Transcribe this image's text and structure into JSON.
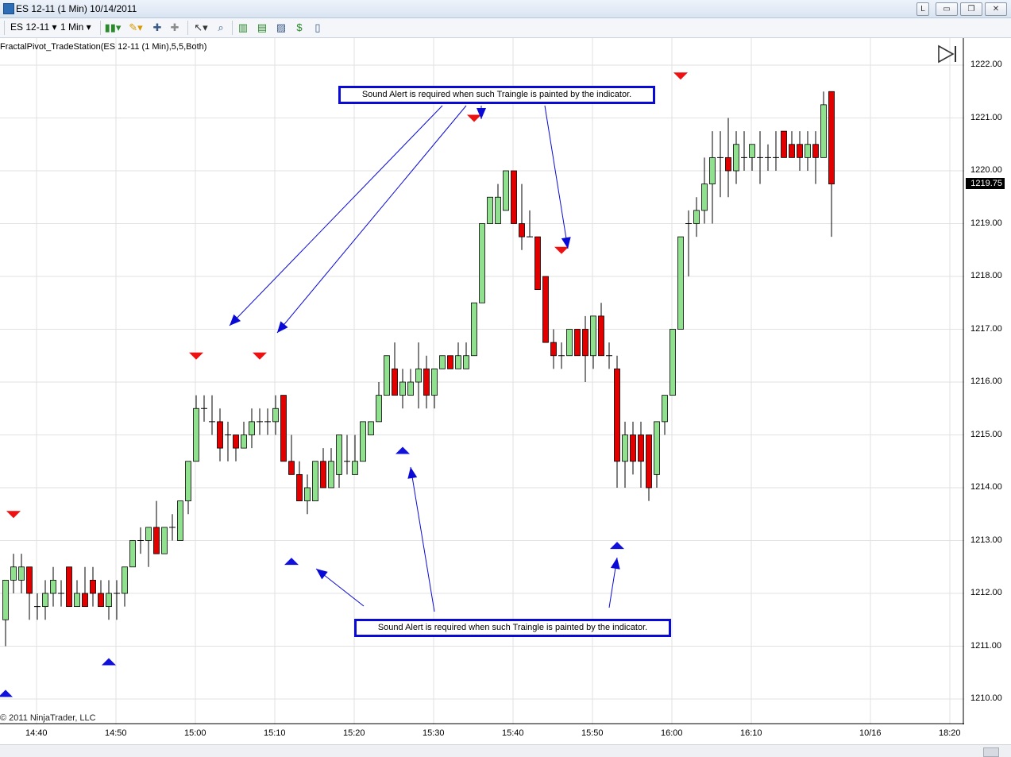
{
  "window": {
    "title": "ES 12-11 (1 Min)  10/14/2011",
    "buttons": [
      "L",
      "▭",
      "❐",
      "✕"
    ]
  },
  "toolbar": {
    "instrument": "ES 12-11",
    "interval": "1 Min",
    "icons": [
      "candlestick-style-icon",
      "pencil-draw-icon",
      "insert-marker-icon",
      "remove-marker-icon",
      "cursor-pointer-icon",
      "zoom-icon",
      "bar-data-icon",
      "properties-icon",
      "chart-trader-icon",
      "dollar-icon",
      "strategy-icon"
    ]
  },
  "indicator_label": "FractalPivot_TradeStation(ES 12-11 (1 Min),5,5,Both)",
  "copyright": "© 2011 NinjaTrader, LLC",
  "current_price": "1219.75",
  "colors": {
    "up": "#90e090",
    "down": "#e00000",
    "up_arrow": "#1111dd",
    "down_arrow": "#ee1111",
    "annotation": "#0a0ad6",
    "grid": "#e2e2e2"
  },
  "annotations": {
    "top_text": "Sound Alert is required when such Traingle is painted by the indicator.",
    "bottom_text": "Sound Alert is required when such Traingle is painted by the indicator."
  },
  "chart_data": {
    "type": "candlestick",
    "x_ticks": [
      "14:40",
      "14:50",
      "15:00",
      "15:10",
      "15:20",
      "15:30",
      "15:40",
      "15:50",
      "16:00",
      "16:10",
      "10/16",
      "18:20"
    ],
    "y_ticks": [
      "1222.00",
      "1221.00",
      "1220.00",
      "1219.00",
      "1218.00",
      "1217.00",
      "1216.00",
      "1215.00",
      "1214.00",
      "1213.00",
      "1212.00",
      "1211.00",
      "1210.00"
    ],
    "ylim": [
      1209.5,
      1222.2
    ],
    "time_start": "14:37",
    "candles": [
      [
        1211.5,
        1212.25,
        1211.0,
        1212.25
      ],
      [
        1212.25,
        1212.75,
        1212.0,
        1212.5
      ],
      [
        1212.25,
        1212.75,
        1212.0,
        1212.5
      ],
      [
        1212.5,
        1212.5,
        1211.5,
        1212.0
      ],
      [
        1211.75,
        1212.0,
        1211.5,
        1211.75
      ],
      [
        1211.75,
        1212.25,
        1211.5,
        1212.0
      ],
      [
        1212.0,
        1212.5,
        1211.75,
        1212.25
      ],
      [
        1212.0,
        1212.25,
        1211.75,
        1212.0
      ],
      [
        1212.5,
        1212.5,
        1211.75,
        1211.75
      ],
      [
        1211.75,
        1212.25,
        1211.75,
        1212.0
      ],
      [
        1212.0,
        1212.5,
        1211.75,
        1211.75
      ],
      [
        1212.25,
        1212.5,
        1211.75,
        1212.0
      ],
      [
        1212.0,
        1212.25,
        1211.75,
        1211.75
      ],
      [
        1211.75,
        1212.25,
        1211.5,
        1212.0
      ],
      [
        1212.0,
        1212.25,
        1211.5,
        1212.0
      ],
      [
        1212.0,
        1212.5,
        1211.75,
        1212.5
      ],
      [
        1212.5,
        1213.0,
        1212.5,
        1213.0
      ],
      [
        1213.0,
        1213.25,
        1212.75,
        1213.0
      ],
      [
        1213.0,
        1213.25,
        1212.5,
        1213.25
      ],
      [
        1213.25,
        1213.75,
        1212.75,
        1212.75
      ],
      [
        1212.75,
        1213.25,
        1212.75,
        1213.25
      ],
      [
        1213.25,
        1213.5,
        1213.0,
        1213.25
      ],
      [
        1213.0,
        1213.75,
        1213.0,
        1213.75
      ],
      [
        1213.75,
        1214.25,
        1213.5,
        1214.5
      ],
      [
        1214.5,
        1215.75,
        1214.5,
        1215.5
      ],
      [
        1215.5,
        1215.75,
        1215.25,
        1215.5
      ],
      [
        1215.25,
        1215.75,
        1215.0,
        1215.25
      ],
      [
        1215.25,
        1215.5,
        1214.5,
        1214.75
      ],
      [
        1215.0,
        1215.25,
        1214.5,
        1215.0
      ],
      [
        1215.0,
        1215.0,
        1214.5,
        1214.75
      ],
      [
        1214.75,
        1215.25,
        1214.75,
        1215.0
      ],
      [
        1215.0,
        1215.5,
        1214.75,
        1215.25
      ],
      [
        1215.25,
        1215.5,
        1215.0,
        1215.25
      ],
      [
        1215.25,
        1215.5,
        1215.0,
        1215.25
      ],
      [
        1215.25,
        1215.75,
        1215.0,
        1215.5
      ],
      [
        1215.75,
        1215.75,
        1214.5,
        1214.5
      ],
      [
        1214.5,
        1215.0,
        1214.25,
        1214.25
      ],
      [
        1214.25,
        1214.5,
        1213.75,
        1213.75
      ],
      [
        1213.75,
        1214.25,
        1213.5,
        1214.0
      ],
      [
        1213.75,
        1214.5,
        1213.75,
        1214.5
      ],
      [
        1214.5,
        1214.75,
        1214.0,
        1214.0
      ],
      [
        1214.0,
        1214.75,
        1214.0,
        1214.5
      ],
      [
        1214.25,
        1215.0,
        1214.0,
        1215.0
      ],
      [
        1214.5,
        1215.0,
        1214.25,
        1214.5
      ],
      [
        1214.25,
        1215.0,
        1214.25,
        1214.5
      ],
      [
        1214.5,
        1215.25,
        1214.5,
        1215.25
      ],
      [
        1215.0,
        1215.25,
        1215.0,
        1215.25
      ],
      [
        1215.25,
        1216.0,
        1215.25,
        1215.75
      ],
      [
        1215.75,
        1216.25,
        1215.75,
        1216.5
      ],
      [
        1216.25,
        1216.75,
        1215.75,
        1215.75
      ],
      [
        1215.75,
        1216.25,
        1215.5,
        1216.0
      ],
      [
        1215.75,
        1216.25,
        1215.75,
        1216.0
      ],
      [
        1216.0,
        1216.75,
        1215.5,
        1216.25
      ],
      [
        1216.25,
        1216.5,
        1215.5,
        1215.75
      ],
      [
        1215.75,
        1216.25,
        1215.5,
        1216.25
      ],
      [
        1216.25,
        1216.5,
        1216.25,
        1216.5
      ],
      [
        1216.5,
        1216.5,
        1216.25,
        1216.25
      ],
      [
        1216.25,
        1216.75,
        1216.25,
        1216.5
      ],
      [
        1216.25,
        1216.75,
        1216.25,
        1216.5
      ],
      [
        1216.5,
        1217.0,
        1216.5,
        1217.5
      ],
      [
        1217.5,
        1218.0,
        1217.5,
        1219.0
      ],
      [
        1219.0,
        1219.25,
        1219.0,
        1219.5
      ],
      [
        1219.0,
        1219.75,
        1219.0,
        1219.5
      ],
      [
        1219.25,
        1219.75,
        1219.25,
        1220.0
      ],
      [
        1220.0,
        1220.0,
        1219.0,
        1219.0
      ],
      [
        1219.0,
        1219.75,
        1218.5,
        1218.75
      ],
      [
        1218.75,
        1219.25,
        1218.75,
        1218.75
      ],
      [
        1218.75,
        1218.75,
        1217.75,
        1217.75
      ],
      [
        1218.0,
        1218.0,
        1216.75,
        1216.75
      ],
      [
        1216.75,
        1217.0,
        1216.25,
        1216.5
      ],
      [
        1216.5,
        1216.75,
        1216.25,
        1216.5
      ],
      [
        1216.5,
        1217.0,
        1216.5,
        1217.0
      ],
      [
        1217.0,
        1217.0,
        1216.5,
        1216.5
      ],
      [
        1217.0,
        1217.25,
        1216.0,
        1216.5
      ],
      [
        1216.5,
        1217.25,
        1216.25,
        1217.25
      ],
      [
        1217.25,
        1217.5,
        1216.5,
        1216.5
      ],
      [
        1216.5,
        1216.75,
        1216.25,
        1216.5
      ],
      [
        1216.25,
        1216.5,
        1214.0,
        1214.5
      ],
      [
        1214.5,
        1215.25,
        1214.0,
        1215.0
      ],
      [
        1215.0,
        1215.25,
        1214.25,
        1214.5
      ],
      [
        1215.0,
        1215.25,
        1214.0,
        1214.5
      ],
      [
        1215.0,
        1215.0,
        1213.75,
        1214.0
      ],
      [
        1214.25,
        1215.25,
        1214.0,
        1215.25
      ],
      [
        1215.25,
        1215.75,
        1215.0,
        1215.75
      ],
      [
        1215.75,
        1217.0,
        1215.75,
        1217.0
      ],
      [
        1217.0,
        1218.75,
        1217.0,
        1218.75
      ],
      [
        1219.0,
        1219.25,
        1218.0,
        1219.0
      ],
      [
        1219.0,
        1219.5,
        1218.75,
        1219.25
      ],
      [
        1219.25,
        1220.25,
        1219.0,
        1219.75
      ],
      [
        1219.75,
        1220.75,
        1219.0,
        1220.25
      ],
      [
        1220.25,
        1220.75,
        1219.5,
        1220.25
      ],
      [
        1220.25,
        1221.0,
        1219.5,
        1220.0
      ],
      [
        1220.0,
        1220.75,
        1219.75,
        1220.5
      ],
      [
        1220.25,
        1220.75,
        1220.0,
        1220.25
      ],
      [
        1220.25,
        1220.5,
        1220.0,
        1220.5
      ],
      [
        1220.25,
        1220.75,
        1219.75,
        1220.25
      ],
      [
        1220.25,
        1220.5,
        1220.0,
        1220.25
      ],
      [
        1220.25,
        1220.75,
        1220.0,
        1220.25
      ],
      [
        1220.75,
        1220.75,
        1220.25,
        1220.25
      ],
      [
        1220.5,
        1220.75,
        1220.25,
        1220.25
      ],
      [
        1220.5,
        1220.75,
        1220.0,
        1220.25
      ],
      [
        1220.25,
        1220.75,
        1220.0,
        1220.5
      ],
      [
        1220.5,
        1220.75,
        1219.75,
        1220.25
      ],
      [
        1220.25,
        1221.5,
        1220.25,
        1221.25
      ],
      [
        1221.5,
        1221.5,
        1218.75,
        1219.75
      ]
    ],
    "fractal_down_red": [
      [
        1,
        1213.5
      ],
      [
        24,
        1216.5
      ],
      [
        32,
        1216.5
      ],
      [
        59,
        1221.0
      ],
      [
        70,
        1218.5
      ],
      [
        85,
        1221.8
      ]
    ],
    "fractal_up_blue": [
      [
        0,
        1210.1
      ],
      [
        13,
        1210.7
      ],
      [
        36,
        1212.6
      ],
      [
        50,
        1214.7
      ],
      [
        77,
        1212.9
      ]
    ]
  }
}
